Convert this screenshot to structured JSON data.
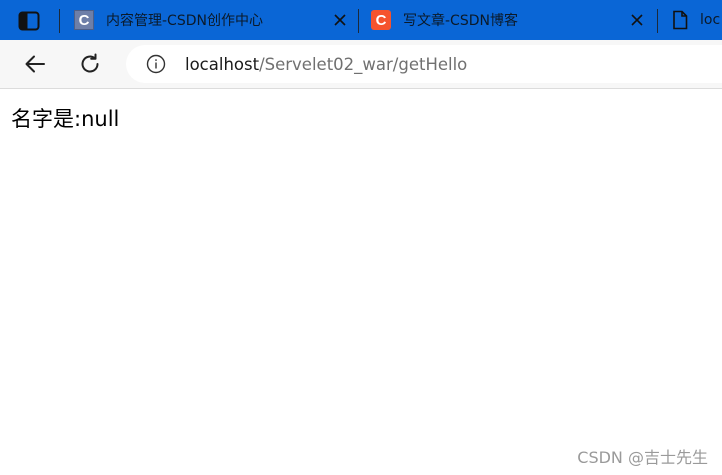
{
  "tabs": [
    {
      "title": "内容管理-CSDN创作中心",
      "favicon_letter": "C",
      "favicon_color": "#6e7fa8"
    },
    {
      "title": "写文章-CSDN博客",
      "favicon_letter": "C",
      "favicon_color": "#f5532d"
    },
    {
      "title": "loc",
      "favicon_letter": ""
    }
  ],
  "address_bar": {
    "host": "localhost",
    "path": "/Servelet02_war/getHello"
  },
  "page": {
    "message": "名字是:null"
  },
  "watermark": "CSDN @吉士先生",
  "colors": {
    "tabstrip": "#0a66d6",
    "toolbar": "#f7f7f7"
  },
  "icons": {
    "tab_actions": "tab-actions-icon",
    "close": "close-icon",
    "back": "back-arrow-icon",
    "reload": "reload-icon",
    "info": "info-icon",
    "page": "page-icon"
  }
}
